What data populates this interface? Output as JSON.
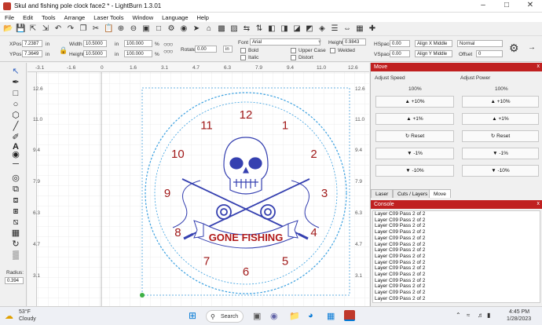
{
  "window": {
    "title": "Skul and fishing pole clock face2 * - LightBurn 1.3.01"
  },
  "menu": [
    "File",
    "Edit",
    "Tools",
    "Arrange",
    "Laser Tools",
    "Window",
    "Language",
    "Help"
  ],
  "toolbar2": {
    "xpos_label": "XPos",
    "xpos": "7.2387",
    "ypos_label": "YPos",
    "ypos": "7.3649",
    "width_label": "Width",
    "width": "10.5000",
    "height_label": "Height",
    "height": "10.5000",
    "unit": "in",
    "scale_w": "100.000",
    "scale_h": "100.000",
    "pct": "%",
    "rotate_label": "Rotate",
    "rotate": "0.00",
    "font_label": "Font",
    "font": "Arial",
    "font_height_label": "Height",
    "font_height": "0.9843",
    "hspace_label": "HSpace",
    "hspace": "0.00",
    "vspace_label": "VSpace",
    "vspace": "0.00",
    "align_x": "Align X Middle",
    "align_y": "Align Y Middle",
    "normal": "Normal",
    "offset_label": "Offset",
    "offset": "0",
    "bold": "Bold",
    "italic": "Italic",
    "upper": "Upper Case",
    "distort": "Distort",
    "welded": "Welded"
  },
  "ruler_top": [
    "-3.1",
    "-1.6",
    "0",
    "1.6",
    "3.1",
    "4.7",
    "6.3",
    "7.9",
    "9.4",
    "11.0",
    "12.6"
  ],
  "ruler_left": [
    "12.6",
    "11.0",
    "9.4",
    "7.9",
    "6.3",
    "4.7",
    "3.1"
  ],
  "ruler_right": [
    "12.6",
    "11.0",
    "9.4",
    "7.9",
    "6.3",
    "4.7",
    "3.1"
  ],
  "sidebar": {
    "radius_label": "Radius:",
    "radius": "0.394"
  },
  "clock": {
    "numbers": [
      "12",
      "1",
      "2",
      "3",
      "4",
      "5",
      "6",
      "7",
      "8",
      "9",
      "10",
      "11"
    ],
    "banner": "GONE FISHING"
  },
  "move_panel": {
    "title": "Move",
    "close": "x",
    "speed_label": "Adjust Speed",
    "power_label": "Adjust Power",
    "pct": "100%",
    "buttons": [
      "+10%",
      "+1%",
      "Reset",
      "-1%",
      "-10%"
    ]
  },
  "tabs": [
    "Laser",
    "Cuts / Layers",
    "Move"
  ],
  "console": {
    "title": "Console",
    "close": "x",
    "line": "Layer C09 Pass 2 of 2",
    "lines": [
      "Layer C09 Pass 2 of 2",
      "Layer C09 Pass 2 of 2",
      "Layer C09 Pass 2 of 2",
      "Layer C09 Pass 2 of 2",
      "Layer C09 Pass 2 of 2",
      "Layer C09 Pass 2 of 2",
      "Layer C09 Pass 2 of 2",
      "Layer C09 Pass 2 of 2",
      "Layer C09 Pass 2 of 2",
      "Layer C09 Pass 2 of 2",
      "Layer C09 Pass 2 of 2",
      "Layer C09 Pass 2 of 2",
      "Layer C09 Pass 2 of 2",
      "Layer C09 Pass 2 of 2",
      "Layer C09 Pass 2 of 2"
    ]
  },
  "taskbar": {
    "weather_temp": "53°F",
    "weather_desc": "Cloudy",
    "search": "Search",
    "time": "4:45 PM",
    "date": "1/28/2023"
  },
  "colors": {
    "accent": "#c02020",
    "clock_number": "#a01818",
    "art": "#3540b0",
    "circle": "#3aa0e0"
  }
}
